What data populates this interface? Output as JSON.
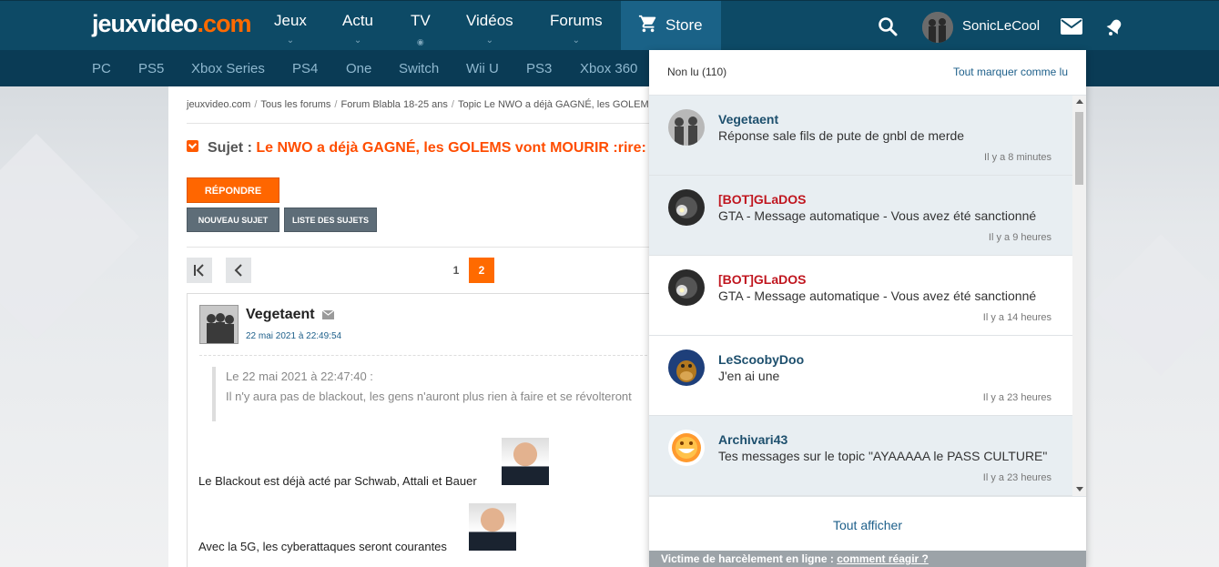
{
  "header": {
    "logo": "jeuxvideo",
    "logo_tld": ".com",
    "nav": [
      {
        "label": "Jeux",
        "indicator": "chevron-down"
      },
      {
        "label": "Actu",
        "indicator": "chevron-down"
      },
      {
        "label": "TV",
        "indicator": "dot"
      },
      {
        "label": "Vidéos",
        "indicator": "chevron-down"
      },
      {
        "label": "Forums",
        "indicator": "chevron-down"
      }
    ],
    "store_label": "Store",
    "username": "SonicLeCool"
  },
  "subnav": [
    "PC",
    "PS5",
    "Xbox Series",
    "PS4",
    "One",
    "Switch",
    "Wii U",
    "PS3",
    "Xbox 360"
  ],
  "forum": {
    "breadcrumb": [
      "jeuxvideo.com",
      "Tous les forums",
      "Forum Blabla 18-25 ans",
      "Topic Le NWO a déjà GAGNÉ, les GOLEMS vont"
    ],
    "subject_label": "Sujet :",
    "subject_title": "Le NWO a déjà GAGNÉ, les GOLEMS vont MOURIR :rire:",
    "reply_label": "RÉPONDRE",
    "new_topic_label": "NOUVEAU SUJET",
    "topic_list_label": "LISTE DES SUJETS",
    "pages": [
      "1",
      "2"
    ],
    "current_page": "2",
    "post": {
      "author": "Vegetaent",
      "date": "22 mai 2021 à 22:49:54",
      "quote_header": "Le 22 mai 2021 à 22:47:40 :",
      "quote_text": "Il n'y aura pas de blackout, les gens n'auront plus rien à faire et se révolteront",
      "line1": "Le Blackout est déjà acté par Schwab, Attali et Bauer",
      "line2": "Avec la 5G, les cyberattaques seront courantes"
    }
  },
  "notifications": {
    "unread_label": "Non lu (110)",
    "mark_all_label": "Tout marquer comme lu",
    "items": [
      {
        "author": "Vegetaent",
        "message": "Réponse sale fils de pute de gnbl de merde",
        "time": "Il y a 8 minutes",
        "unread": true,
        "author_color": "#1d4f6d"
      },
      {
        "author": "[BOT]GLaDOS",
        "message": "GTA - Message automatique - Vous avez été sanctionné",
        "time": "Il y a 9 heures",
        "unread": true,
        "author_color": "#c0161f"
      },
      {
        "author": "[BOT]GLaDOS",
        "message": "GTA - Message automatique - Vous avez été sanctionné",
        "time": "Il y a 14 heures",
        "unread": false,
        "author_color": "#c0161f"
      },
      {
        "author": "LeScoobyDoo",
        "message": "J'en ai une",
        "time": "Il y a 23 heures",
        "unread": false,
        "author_color": "#1d4f6d"
      },
      {
        "author": "Archivari43",
        "message": "Tes messages sur le topic \"AYAAAAA le PASS CULTURE\"",
        "time": "Il y a 23 heures",
        "unread": true,
        "author_color": "#1d4f6d"
      }
    ],
    "show_all_label": "Tout afficher",
    "footer_text": "Victime de harcèlement en ligne :",
    "footer_link": "comment réagir ?"
  }
}
